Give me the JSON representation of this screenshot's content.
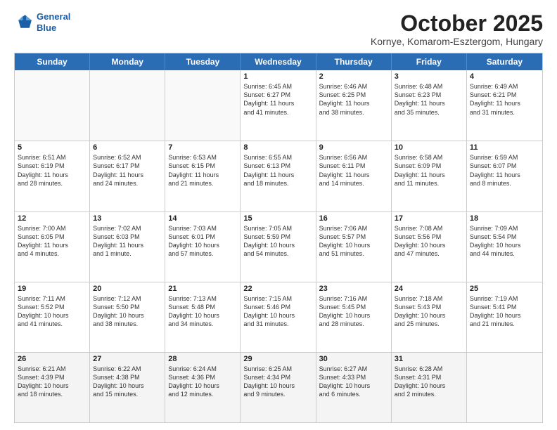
{
  "logo": {
    "line1": "General",
    "line2": "Blue"
  },
  "title": "October 2025",
  "location": "Kornye, Komarom-Esztergom, Hungary",
  "header_days": [
    "Sunday",
    "Monday",
    "Tuesday",
    "Wednesday",
    "Thursday",
    "Friday",
    "Saturday"
  ],
  "rows": [
    [
      {
        "num": "",
        "text": ""
      },
      {
        "num": "",
        "text": ""
      },
      {
        "num": "",
        "text": ""
      },
      {
        "num": "1",
        "text": "Sunrise: 6:45 AM\nSunset: 6:27 PM\nDaylight: 11 hours\nand 41 minutes."
      },
      {
        "num": "2",
        "text": "Sunrise: 6:46 AM\nSunset: 6:25 PM\nDaylight: 11 hours\nand 38 minutes."
      },
      {
        "num": "3",
        "text": "Sunrise: 6:48 AM\nSunset: 6:23 PM\nDaylight: 11 hours\nand 35 minutes."
      },
      {
        "num": "4",
        "text": "Sunrise: 6:49 AM\nSunset: 6:21 PM\nDaylight: 11 hours\nand 31 minutes."
      }
    ],
    [
      {
        "num": "5",
        "text": "Sunrise: 6:51 AM\nSunset: 6:19 PM\nDaylight: 11 hours\nand 28 minutes."
      },
      {
        "num": "6",
        "text": "Sunrise: 6:52 AM\nSunset: 6:17 PM\nDaylight: 11 hours\nand 24 minutes."
      },
      {
        "num": "7",
        "text": "Sunrise: 6:53 AM\nSunset: 6:15 PM\nDaylight: 11 hours\nand 21 minutes."
      },
      {
        "num": "8",
        "text": "Sunrise: 6:55 AM\nSunset: 6:13 PM\nDaylight: 11 hours\nand 18 minutes."
      },
      {
        "num": "9",
        "text": "Sunrise: 6:56 AM\nSunset: 6:11 PM\nDaylight: 11 hours\nand 14 minutes."
      },
      {
        "num": "10",
        "text": "Sunrise: 6:58 AM\nSunset: 6:09 PM\nDaylight: 11 hours\nand 11 minutes."
      },
      {
        "num": "11",
        "text": "Sunrise: 6:59 AM\nSunset: 6:07 PM\nDaylight: 11 hours\nand 8 minutes."
      }
    ],
    [
      {
        "num": "12",
        "text": "Sunrise: 7:00 AM\nSunset: 6:05 PM\nDaylight: 11 hours\nand 4 minutes."
      },
      {
        "num": "13",
        "text": "Sunrise: 7:02 AM\nSunset: 6:03 PM\nDaylight: 11 hours\nand 1 minute."
      },
      {
        "num": "14",
        "text": "Sunrise: 7:03 AM\nSunset: 6:01 PM\nDaylight: 10 hours\nand 57 minutes."
      },
      {
        "num": "15",
        "text": "Sunrise: 7:05 AM\nSunset: 5:59 PM\nDaylight: 10 hours\nand 54 minutes."
      },
      {
        "num": "16",
        "text": "Sunrise: 7:06 AM\nSunset: 5:57 PM\nDaylight: 10 hours\nand 51 minutes."
      },
      {
        "num": "17",
        "text": "Sunrise: 7:08 AM\nSunset: 5:56 PM\nDaylight: 10 hours\nand 47 minutes."
      },
      {
        "num": "18",
        "text": "Sunrise: 7:09 AM\nSunset: 5:54 PM\nDaylight: 10 hours\nand 44 minutes."
      }
    ],
    [
      {
        "num": "19",
        "text": "Sunrise: 7:11 AM\nSunset: 5:52 PM\nDaylight: 10 hours\nand 41 minutes."
      },
      {
        "num": "20",
        "text": "Sunrise: 7:12 AM\nSunset: 5:50 PM\nDaylight: 10 hours\nand 38 minutes."
      },
      {
        "num": "21",
        "text": "Sunrise: 7:13 AM\nSunset: 5:48 PM\nDaylight: 10 hours\nand 34 minutes."
      },
      {
        "num": "22",
        "text": "Sunrise: 7:15 AM\nSunset: 5:46 PM\nDaylight: 10 hours\nand 31 minutes."
      },
      {
        "num": "23",
        "text": "Sunrise: 7:16 AM\nSunset: 5:45 PM\nDaylight: 10 hours\nand 28 minutes."
      },
      {
        "num": "24",
        "text": "Sunrise: 7:18 AM\nSunset: 5:43 PM\nDaylight: 10 hours\nand 25 minutes."
      },
      {
        "num": "25",
        "text": "Sunrise: 7:19 AM\nSunset: 5:41 PM\nDaylight: 10 hours\nand 21 minutes."
      }
    ],
    [
      {
        "num": "26",
        "text": "Sunrise: 6:21 AM\nSunset: 4:39 PM\nDaylight: 10 hours\nand 18 minutes."
      },
      {
        "num": "27",
        "text": "Sunrise: 6:22 AM\nSunset: 4:38 PM\nDaylight: 10 hours\nand 15 minutes."
      },
      {
        "num": "28",
        "text": "Sunrise: 6:24 AM\nSunset: 4:36 PM\nDaylight: 10 hours\nand 12 minutes."
      },
      {
        "num": "29",
        "text": "Sunrise: 6:25 AM\nSunset: 4:34 PM\nDaylight: 10 hours\nand 9 minutes."
      },
      {
        "num": "30",
        "text": "Sunrise: 6:27 AM\nSunset: 4:33 PM\nDaylight: 10 hours\nand 6 minutes."
      },
      {
        "num": "31",
        "text": "Sunrise: 6:28 AM\nSunset: 4:31 PM\nDaylight: 10 hours\nand 2 minutes."
      },
      {
        "num": "",
        "text": ""
      }
    ]
  ]
}
